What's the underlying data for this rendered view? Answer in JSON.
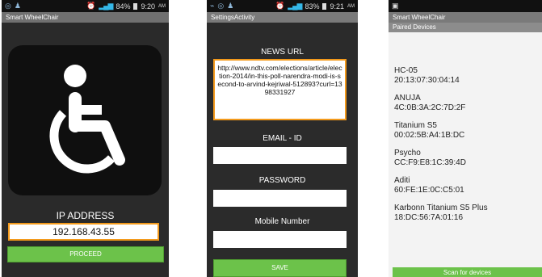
{
  "screen1": {
    "status": {
      "battery": "84%",
      "time": "9:20",
      "ampm": "AM"
    },
    "title": "Smart WheelChair",
    "ip_label": "IP ADDRESS",
    "ip_value": "192.168.43.55",
    "proceed_label": "PROCEED"
  },
  "screen2": {
    "status": {
      "battery": "83%",
      "time": "9:21",
      "ampm": "AM"
    },
    "title": "SettingsActivity",
    "news_url_label": "NEWS URL",
    "news_url_value": "http://www.ndtv.com/elections/article/election-2014/in-this-poll-narendra-modi-is-second-to-arvind-kejriwal-512893?curl=1398331927",
    "email_label": "EMAIL - ID",
    "email_value": "",
    "password_label": "PASSWORD",
    "password_value": "",
    "mobile_label": "Mobile Number",
    "mobile_value": "",
    "save_label": "SAVE"
  },
  "screen3": {
    "title": "Smart WheelChair",
    "subtitle": "Paired Devices",
    "devices": [
      {
        "name": "HC-05",
        "address": "20:13:07:30:04:14"
      },
      {
        "name": "ANUJA",
        "address": "4C:0B:3A:2C:7D:2F"
      },
      {
        "name": "Titanium S5",
        "address": "00:02:5B:A4:1B:DC"
      },
      {
        "name": "Psycho",
        "address": "CC:F9:E8:1C:39:4D"
      },
      {
        "name": "Aditi",
        "address": "60:FE:1E:0C:C5:01"
      },
      {
        "name": "Karbonn Titanium S5 Plus",
        "address": "18:DC:56:7A:01:16"
      }
    ],
    "scan_label": "Scan for devices"
  }
}
